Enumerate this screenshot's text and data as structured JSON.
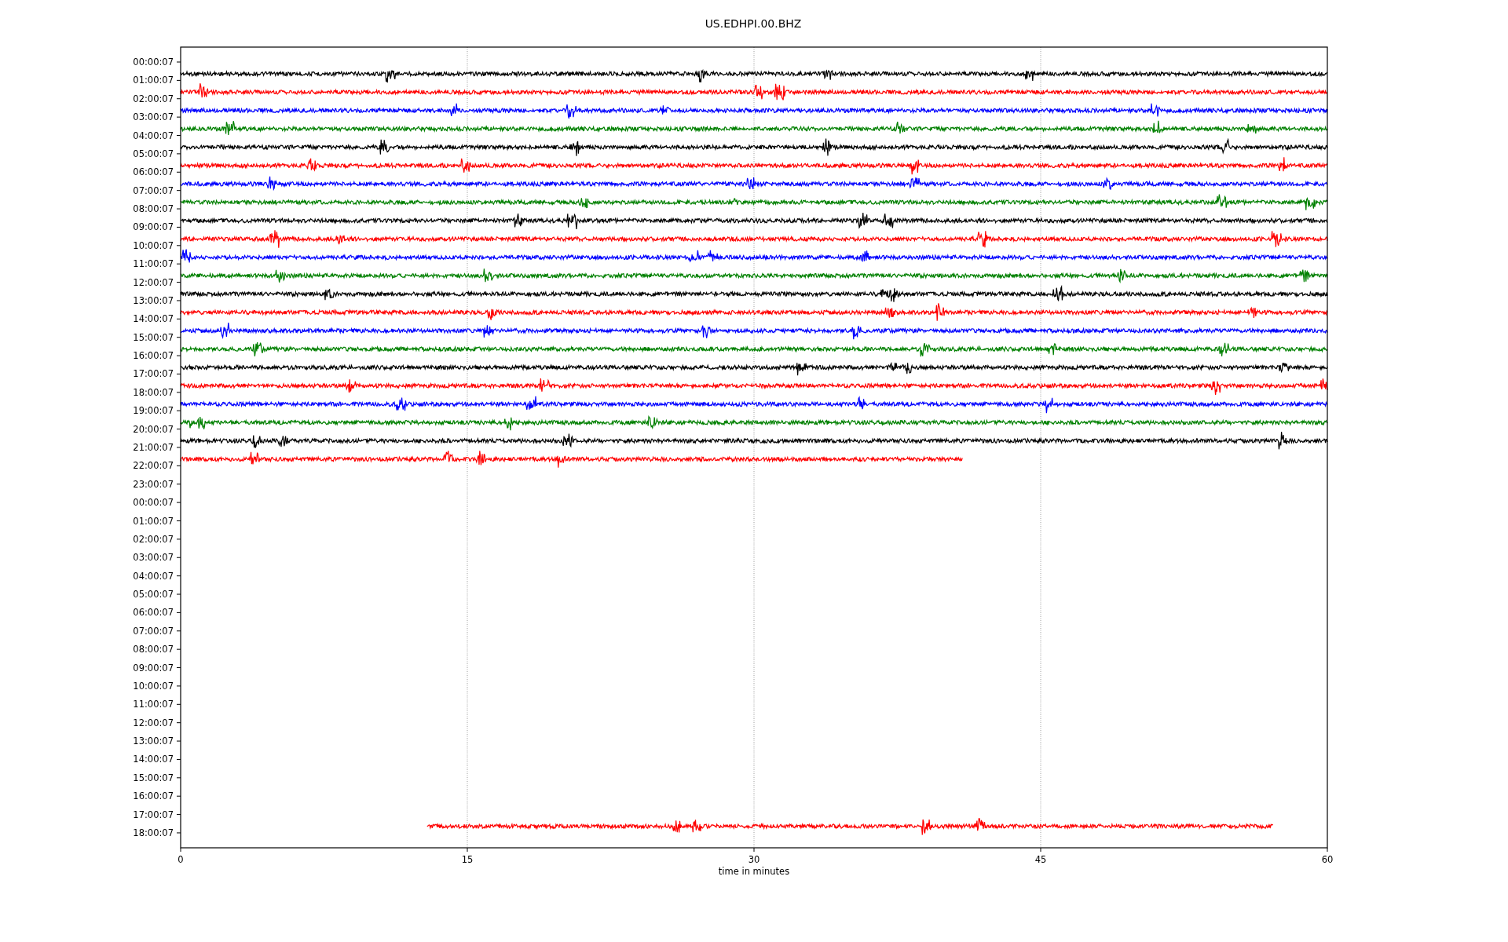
{
  "title": "US.EDHPI.00.BHZ",
  "chart": {
    "x_axis": {
      "label": "time in minutes",
      "ticks": [
        "0",
        "15",
        "30",
        "45",
        "60"
      ]
    },
    "rows": [
      {
        "label": "00:00:07",
        "trace": {
          "color": "#000000",
          "kind": "full"
        }
      },
      {
        "label": "01:00:07",
        "trace": {
          "color": "#ff0000",
          "kind": "full"
        }
      },
      {
        "label": "02:00:07",
        "trace": {
          "color": "#0000ff",
          "kind": "full"
        }
      },
      {
        "label": "03:00:07",
        "trace": {
          "color": "#008000",
          "kind": "full"
        }
      },
      {
        "label": "04:00:07",
        "trace": {
          "color": "#000000",
          "kind": "full"
        }
      },
      {
        "label": "05:00:07",
        "trace": {
          "color": "#ff0000",
          "kind": "full"
        }
      },
      {
        "label": "06:00:07",
        "trace": {
          "color": "#0000ff",
          "kind": "full"
        }
      },
      {
        "label": "07:00:07",
        "trace": {
          "color": "#008000",
          "kind": "full"
        }
      },
      {
        "label": "08:00:07",
        "trace": {
          "color": "#000000",
          "kind": "full"
        }
      },
      {
        "label": "09:00:07",
        "trace": {
          "color": "#ff0000",
          "kind": "full"
        }
      },
      {
        "label": "10:00:07",
        "trace": {
          "color": "#0000ff",
          "kind": "full"
        }
      },
      {
        "label": "11:00:07",
        "trace": {
          "color": "#008000",
          "kind": "full"
        }
      },
      {
        "label": "12:00:07",
        "trace": {
          "color": "#000000",
          "kind": "full"
        }
      },
      {
        "label": "13:00:07",
        "trace": {
          "color": "#ff0000",
          "kind": "full"
        }
      },
      {
        "label": "14:00:07",
        "trace": {
          "color": "#0000ff",
          "kind": "full"
        }
      },
      {
        "label": "15:00:07",
        "trace": {
          "color": "#008000",
          "kind": "full"
        }
      },
      {
        "label": "16:00:07",
        "trace": {
          "color": "#000000",
          "kind": "full"
        }
      },
      {
        "label": "17:00:07",
        "trace": {
          "color": "#ff0000",
          "kind": "full"
        }
      },
      {
        "label": "18:00:07",
        "trace": {
          "color": "#0000ff",
          "kind": "full"
        }
      },
      {
        "label": "19:00:07",
        "trace": {
          "color": "#008000",
          "kind": "full"
        }
      },
      {
        "label": "20:00:07",
        "trace": {
          "color": "#000000",
          "kind": "full"
        }
      },
      {
        "label": "21:00:07",
        "trace": {
          "color": "#ff0000",
          "kind": "tail"
        }
      },
      {
        "label": "22:00:07"
      },
      {
        "label": "23:00:07"
      },
      {
        "label": "00:00:07"
      },
      {
        "label": "01:00:07"
      },
      {
        "label": "02:00:07"
      },
      {
        "label": "03:00:07"
      },
      {
        "label": "04:00:07"
      },
      {
        "label": "05:00:07"
      },
      {
        "label": "06:00:07"
      },
      {
        "label": "07:00:07"
      },
      {
        "label": "08:00:07"
      },
      {
        "label": "09:00:07"
      },
      {
        "label": "10:00:07"
      },
      {
        "label": "11:00:07"
      },
      {
        "label": "12:00:07"
      },
      {
        "label": "13:00:07"
      },
      {
        "label": "14:00:07"
      },
      {
        "label": "15:00:07"
      },
      {
        "label": "16:00:07"
      },
      {
        "label": "17:00:07",
        "trace": {
          "color": "#ff0000",
          "kind": "late"
        }
      },
      {
        "label": "18:00:07"
      }
    ]
  }
}
